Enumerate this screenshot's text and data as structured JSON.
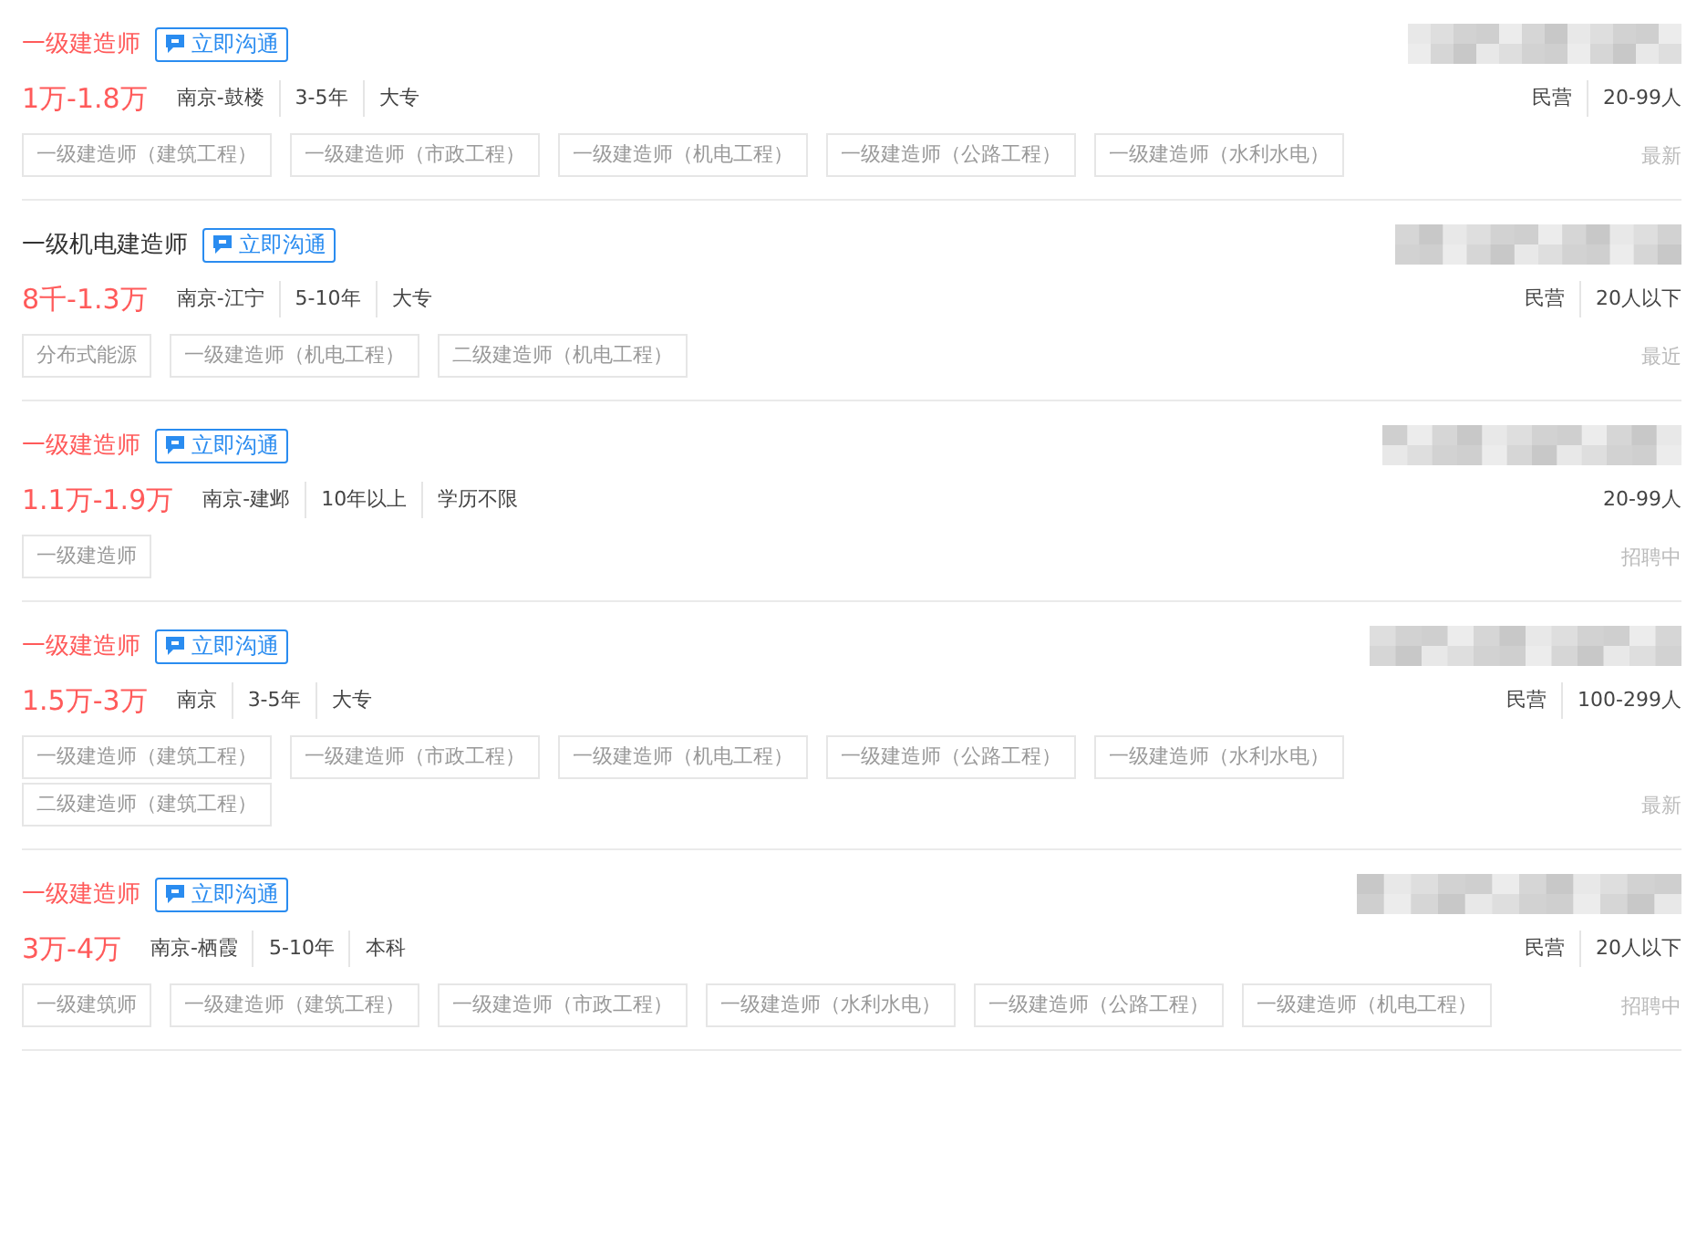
{
  "jobs": [
    {
      "title": "一级建造师",
      "highlighted": true,
      "chat": "立即沟通",
      "salary": "1万-1.8万",
      "meta": [
        "南京-鼓楼",
        "3-5年",
        "大专"
      ],
      "company": [
        "民营",
        "20-99人"
      ],
      "tags": [
        "一级建造师（建筑工程）",
        "一级建造师（市政工程）",
        "一级建造师（机电工程）",
        "一级建造师（公路工程）",
        "一级建造师（水利水电）"
      ],
      "status": "最新"
    },
    {
      "title": "一级机电建造师",
      "highlighted": false,
      "chat": "立即沟通",
      "salary": "8千-1.3万",
      "meta": [
        "南京-江宁",
        "5-10年",
        "大专"
      ],
      "company": [
        "民营",
        "20人以下"
      ],
      "tags": [
        "分布式能源",
        "一级建造师（机电工程）",
        "二级建造师（机电工程）"
      ],
      "status": "最近"
    },
    {
      "title": "一级建造师",
      "highlighted": true,
      "chat": "立即沟通",
      "salary": "1.1万-1.9万",
      "meta": [
        "南京-建邺",
        "10年以上",
        "学历不限"
      ],
      "company": [
        "20-99人"
      ],
      "tags": [
        "一级建造师"
      ],
      "status": "招聘中"
    },
    {
      "title": "一级建造师",
      "highlighted": true,
      "chat": "立即沟通",
      "salary": "1.5万-3万",
      "meta": [
        "南京",
        "3-5年",
        "大专"
      ],
      "company": [
        "民营",
        "100-299人"
      ],
      "tags": [
        "一级建造师（建筑工程）",
        "一级建造师（市政工程）",
        "一级建造师（机电工程）",
        "一级建造师（公路工程）",
        "一级建造师（水利水电）",
        "二级建造师（建筑工程）"
      ],
      "status": "最新"
    },
    {
      "title": "一级建造师",
      "highlighted": true,
      "chat": "立即沟通",
      "salary": "3万-4万",
      "meta": [
        "南京-栖霞",
        "5-10年",
        "本科"
      ],
      "company": [
        "民营",
        "20人以下"
      ],
      "tags": [
        "一级建筑师",
        "一级建造师（建筑工程）",
        "一级建造师（市政工程）",
        "一级建造师（水利水电）",
        "一级建造师（公路工程）",
        "一级建造师（机电工程）"
      ],
      "status": "招聘中"
    }
  ]
}
